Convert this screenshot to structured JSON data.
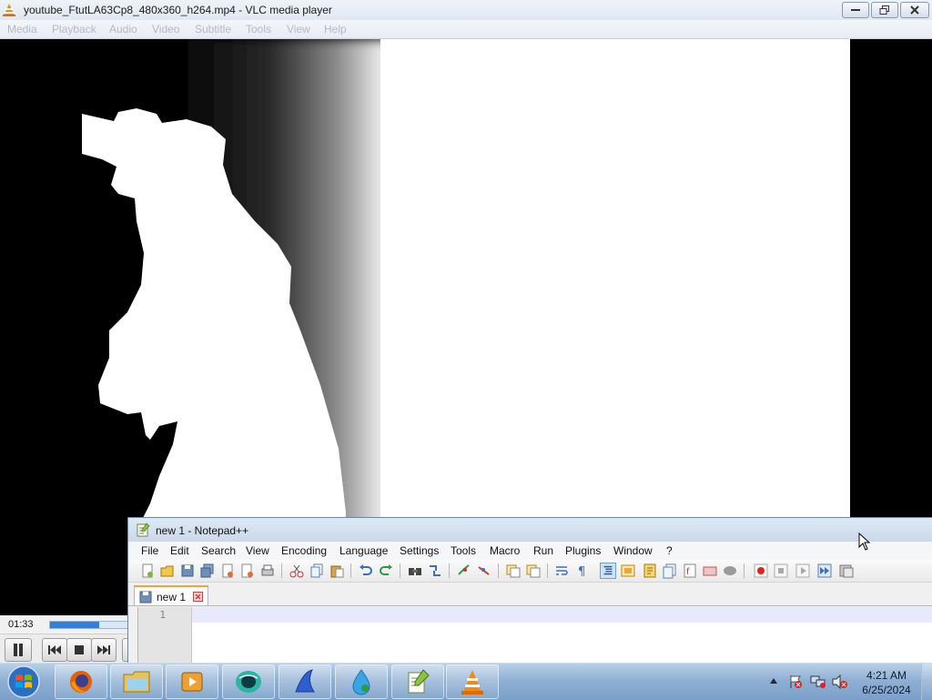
{
  "vlc": {
    "window_title": "youtube_FtutLA63Cp8_480x360_h264.mp4 - VLC media player",
    "menu": [
      "Media",
      "Playback",
      "Audio",
      "Video",
      "Subtitle",
      "Tools",
      "View",
      "Help"
    ],
    "time_elapsed": "01:33",
    "progress_fraction": 0.6,
    "controls": [
      "play-pause",
      "previous",
      "stop",
      "next"
    ]
  },
  "notepadpp": {
    "window_title": "new 1 - Notepad++",
    "menu": [
      "File",
      "Edit",
      "Search",
      "View",
      "Encoding",
      "Language",
      "Settings",
      "Tools",
      "Macro",
      "Run",
      "Plugins",
      "Window",
      "?"
    ],
    "tab_label": "new 1",
    "line_number": "1",
    "editor_text": ""
  },
  "taskbar": {
    "apps": [
      "firefox",
      "file-explorer",
      "media-player",
      "browser-globe",
      "tool-app",
      "water-app",
      "notepadpp",
      "vlc"
    ],
    "clock_time": "4:21 AM",
    "clock_date": "6/25/2024"
  },
  "colors": {
    "vlc_progress": "#2f7fdd",
    "npp_tab_accent": "#f3a33a",
    "npp_current_line": "#e8e8ff",
    "taskbar": "#8fb0d4"
  }
}
